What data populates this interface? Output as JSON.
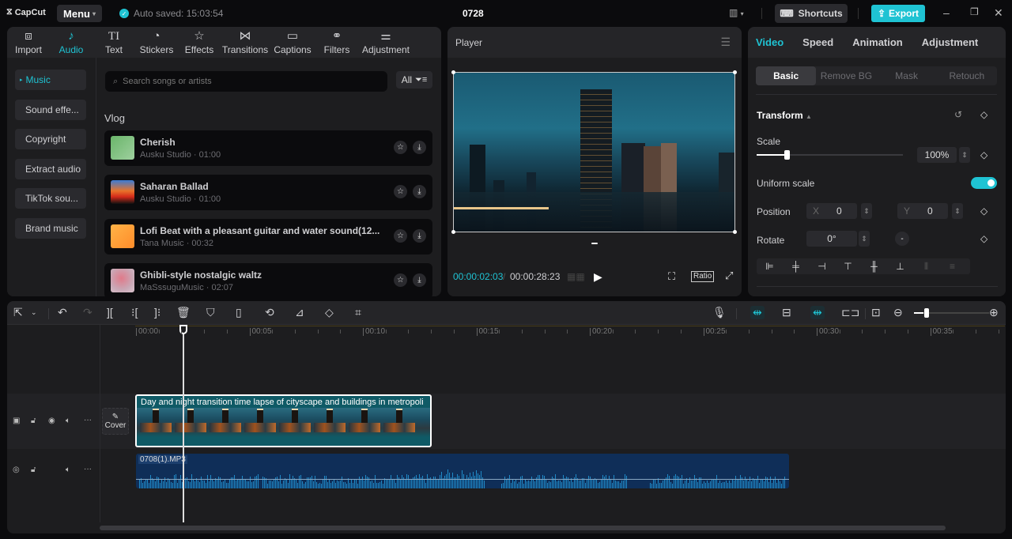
{
  "app": {
    "logo": "CapCut",
    "menu_label": "Menu",
    "autosave": "Auto saved: 15:03:54",
    "project_title": "0728",
    "shortcuts_label": "Shortcuts",
    "export_label": "Export",
    "accent": "#1fc3d3"
  },
  "media": {
    "tabs": [
      {
        "label": "Import",
        "icon": "import-icon"
      },
      {
        "label": "Audio",
        "icon": "music-note-icon",
        "active": true
      },
      {
        "label": "Text",
        "icon": "text-icon"
      },
      {
        "label": "Stickers",
        "icon": "sticker-icon"
      },
      {
        "label": "Effects",
        "icon": "effects-star-icon"
      },
      {
        "label": "Transitions",
        "icon": "transition-icon"
      },
      {
        "label": "Captions",
        "icon": "captions-icon"
      },
      {
        "label": "Filters",
        "icon": "filters-icon"
      },
      {
        "label": "Adjustment",
        "icon": "adjustment-sliders-icon"
      }
    ],
    "sidebar": [
      {
        "label": "Music",
        "active": true
      },
      {
        "label": "Sound effe..."
      },
      {
        "label": "Copyright"
      },
      {
        "label": "Extract audio"
      },
      {
        "label": "TikTok sou..."
      },
      {
        "label": "Brand music"
      }
    ],
    "search_placeholder": "Search songs or artists",
    "filter_label": "All",
    "section_title": "Vlog",
    "songs": [
      {
        "title": "Cherish",
        "subtitle": "Ausku Studio · 01:00"
      },
      {
        "title": "Saharan Ballad",
        "subtitle": "Ausku Studio · 01:00"
      },
      {
        "title": "Lofi Beat with a pleasant guitar and water sound(12...",
        "subtitle": "Tana Music · 00:32"
      },
      {
        "title": "Ghibli-style nostalgic waltz",
        "subtitle": "MaSssuguMusic · 02:07"
      }
    ]
  },
  "player": {
    "title": "Player",
    "current_time": "00:00:02:03",
    "total_time": "00:00:28:23",
    "ratio_label": "Ratio"
  },
  "properties": {
    "tabs": [
      "Video",
      "Speed",
      "Animation",
      "Adjustment"
    ],
    "active_tab": "Video",
    "subtabs": [
      "Basic",
      "Remove BG",
      "Mask",
      "Retouch"
    ],
    "active_subtab": "Basic",
    "section": "Transform",
    "scale_label": "Scale",
    "scale_value": "100%",
    "scale_fraction": 0.2,
    "uniform_scale_label": "Uniform scale",
    "uniform_scale_on": true,
    "position_label": "Position",
    "position_x_label": "X",
    "position_x": "0",
    "position_y_label": "Y",
    "position_y": "0",
    "rotate_label": "Rotate",
    "rotate_value": "0°"
  },
  "timeline": {
    "ticks": [
      "00:00",
      "00:05",
      "00:10",
      "00:15",
      "00:20",
      "00:25",
      "00:30",
      "00:35"
    ],
    "cover_label": "Cover",
    "video_clip_name": "Day and night transition time lapse of cityscape and buildings in metropoli",
    "audio_clip_name": "0708(1).MP3"
  }
}
